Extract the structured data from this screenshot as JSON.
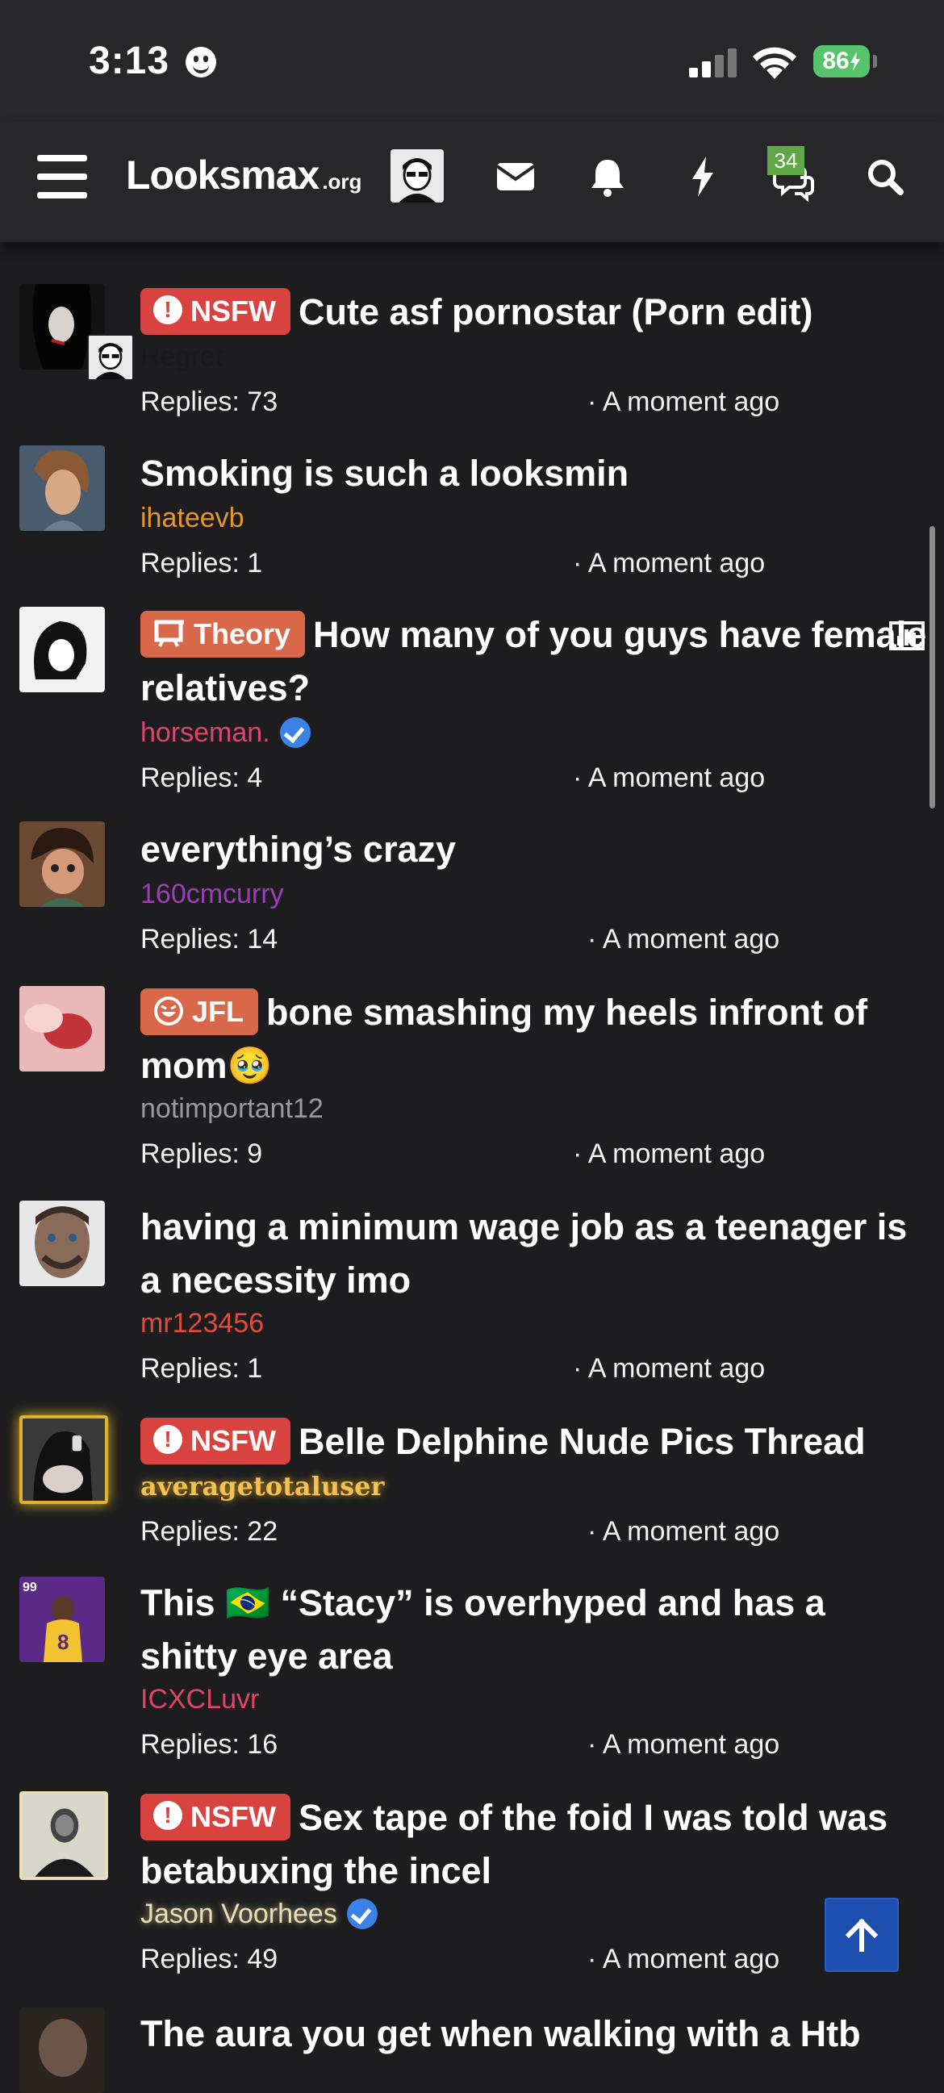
{
  "status_bar": {
    "time": "3:13",
    "battery": "86"
  },
  "header": {
    "logo_main": "Looksmax",
    "logo_suffix": ".org",
    "messages_badge": "34"
  },
  "threads": [
    {
      "prefix": "NSFW",
      "title": "Cute asf pornostar (Porn edit)",
      "author": "Regret",
      "author_color": "#1a1a1a",
      "replies": "Replies: 73",
      "time": "· A moment ago"
    },
    {
      "prefix": "",
      "title": "Smoking is such a looksmin",
      "author": "ihateevb",
      "author_color": "#e6962b",
      "replies": "Replies: 1",
      "time": "· A moment ago"
    },
    {
      "prefix": "Theory",
      "title": "How many of you guys have female relatives?",
      "author": "horseman.",
      "author_color": "#e0446a",
      "replies": "Replies: 4",
      "time": "· A moment ago"
    },
    {
      "prefix": "",
      "title": "everything’s crazy",
      "author": "160cmcurry",
      "author_color": "#9b3fb6",
      "replies": "Replies: 14",
      "time": "· A moment ago"
    },
    {
      "prefix": "JFL",
      "title": "bone smashing my heels infront of mom🥹",
      "author": "notimportant12",
      "author_color": "#9a9a9a",
      "replies": "Replies: 9",
      "time": "· A moment ago"
    },
    {
      "prefix": "",
      "title": "having a minimum wage job as a teenager is a necessity imo",
      "author": "mr123456",
      "author_color": "#e24b3b",
      "replies": "Replies: 1",
      "time": "· A moment ago"
    },
    {
      "prefix": "NSFW",
      "title": "Belle Delphine Nude Pics Thread",
      "author": "averagetotaluser",
      "author_color": "#f2c14e",
      "replies": "Replies: 22",
      "time": "· A moment ago"
    },
    {
      "prefix": "",
      "title": "This 🇧🇷 “Stacy” is overhyped and has a shitty eye area",
      "author": "ICXCLuvr",
      "author_color": "#e0446a",
      "replies": "Replies: 16",
      "time": "· A moment ago"
    },
    {
      "prefix": "NSFW",
      "title": "Sex tape of the foid I was told was betabuxing the incel",
      "author": "Jason Voorhees",
      "author_color": "#e8dfb8",
      "replies": "Replies: 49",
      "time": "· A moment ago"
    },
    {
      "prefix": "",
      "title": "The aura you get when walking with a Htb",
      "author": "",
      "author_color": "#ffffff",
      "replies": "",
      "time": ""
    }
  ]
}
